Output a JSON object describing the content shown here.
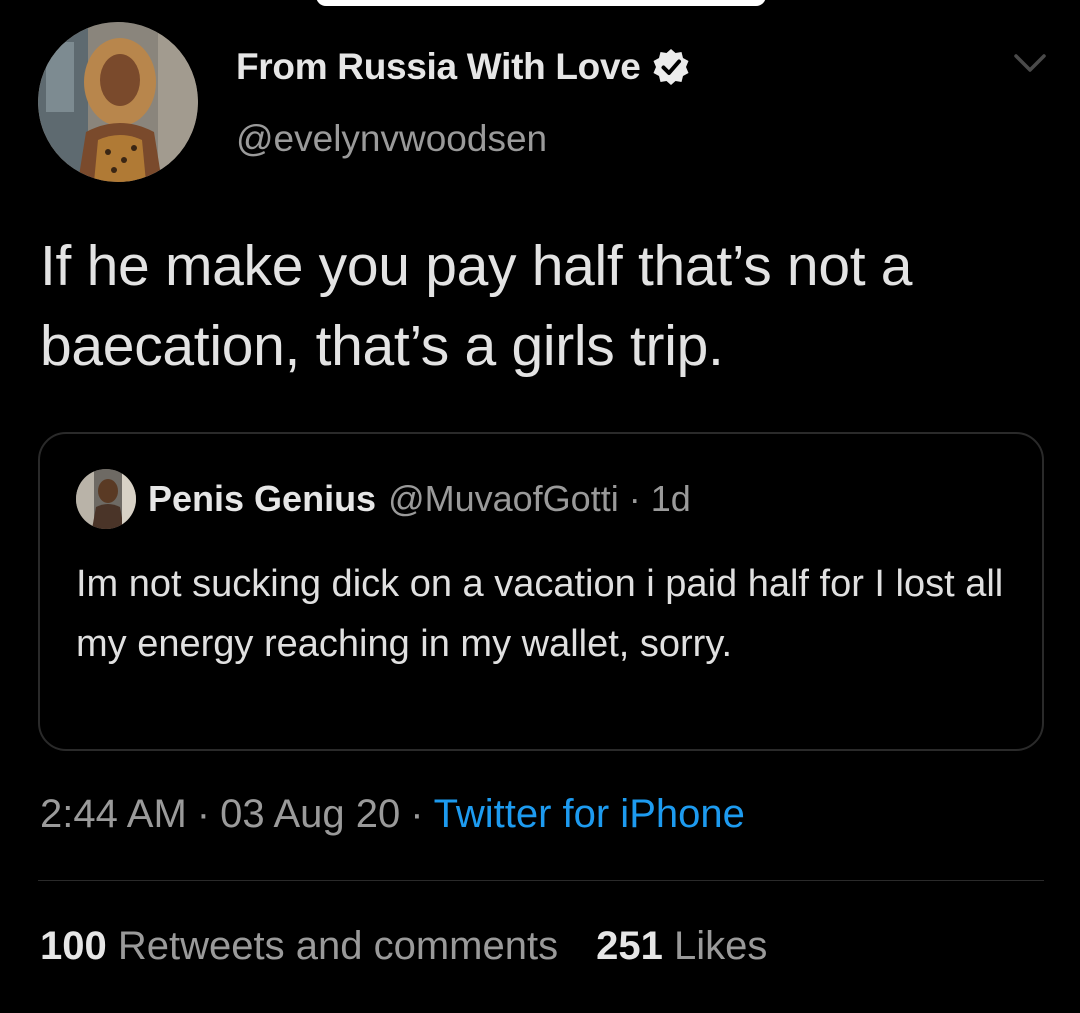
{
  "tweet": {
    "display_name": "From Russia With Love",
    "verified": true,
    "handle": "@evelynvwoodsen",
    "text": "If he make you pay half that’s not a baecation, that’s a girls trip.",
    "time": "2:44 AM",
    "date": "03 Aug 20",
    "source": "Twitter for iPhone",
    "separator": "·"
  },
  "quoted_tweet": {
    "display_name": "Penis Genius",
    "handle": "@MuvaofGotti",
    "separator": "·",
    "age": "1d",
    "text": "Im not sucking dick on a vacation i paid half for I lost all my energy reaching in my wallet, sorry."
  },
  "stats": {
    "retweets_count": "100",
    "retweets_label": "Retweets and comments",
    "likes_count": "251",
    "likes_label": "Likes"
  },
  "icons": {
    "verified": "verified-badge-icon",
    "menu": "chevron-down-icon"
  },
  "colors": {
    "background": "#000000",
    "link": "#1d9bf0",
    "secondary_text": "#9a9a9a",
    "border": "#2a2a2a"
  }
}
